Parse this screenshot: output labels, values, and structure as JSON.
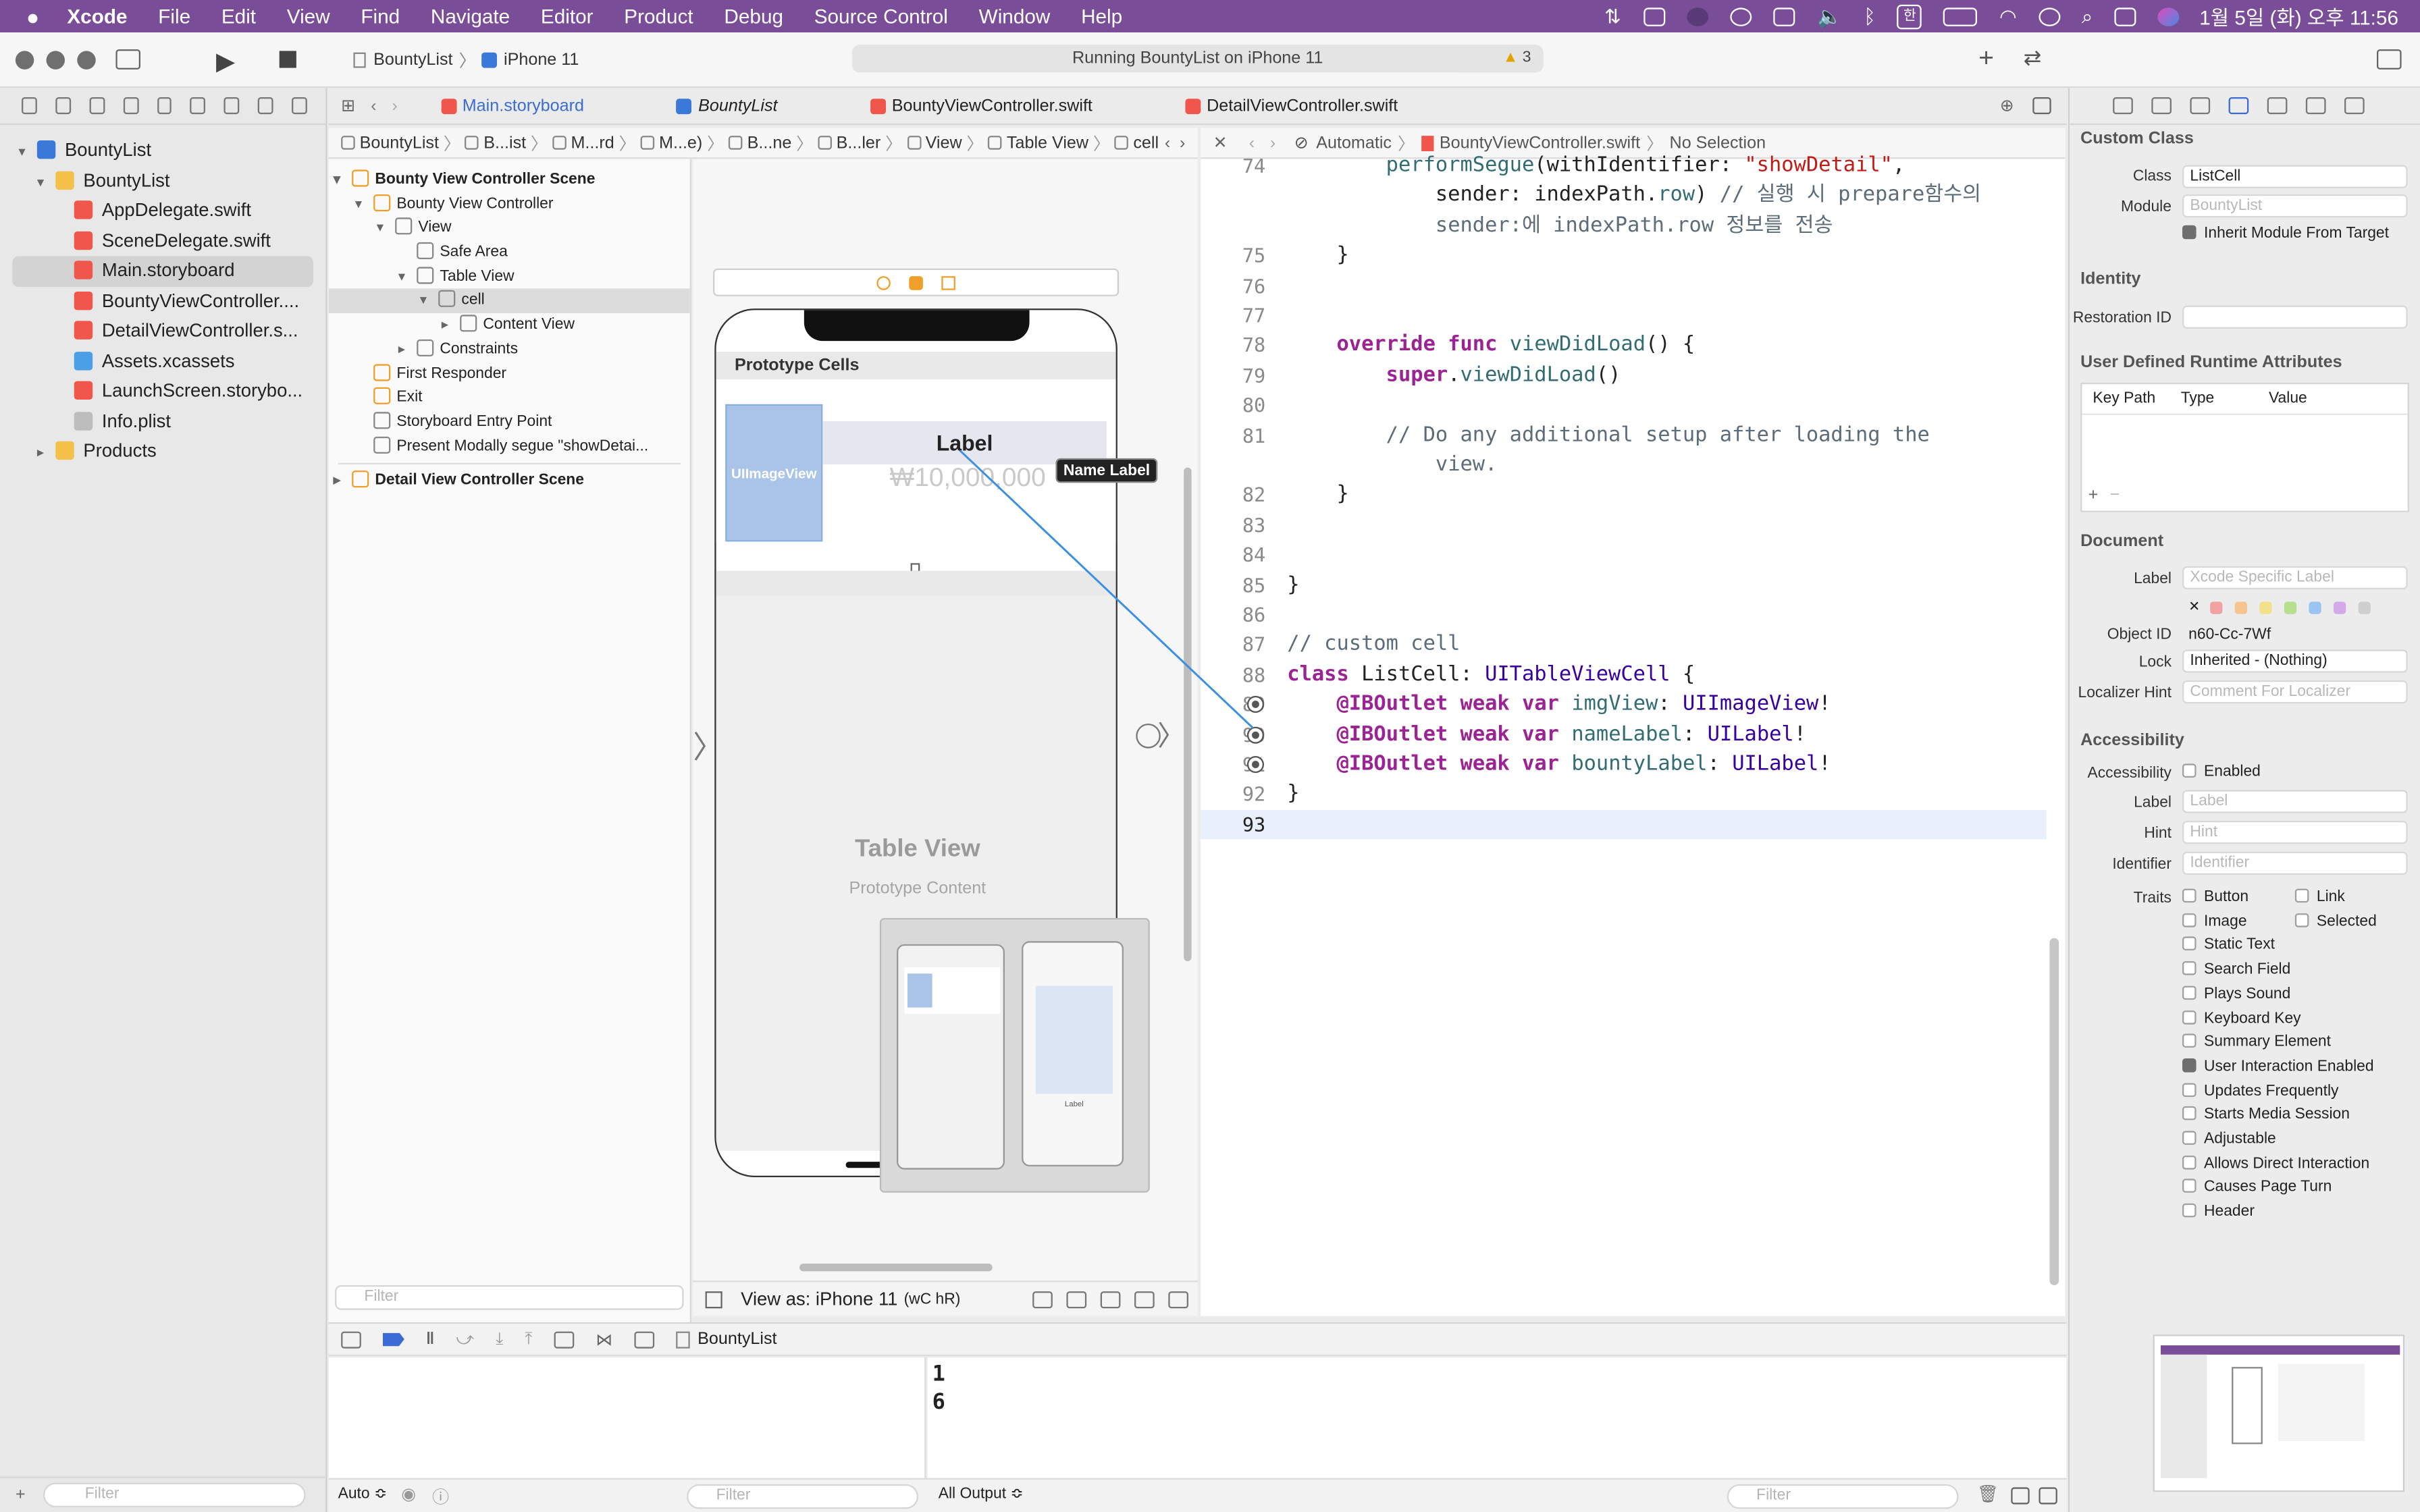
{
  "menubar": {
    "app_name": "Xcode",
    "items": [
      "File",
      "Edit",
      "View",
      "Find",
      "Navigate",
      "Editor",
      "Product",
      "Debug",
      "Source Control",
      "Window",
      "Help"
    ],
    "clock": "1월 5일 (화) 오후 11:56",
    "input_source": "한"
  },
  "toolbar": {
    "scheme": "BountyList",
    "device": "iPhone 11",
    "activity_text": "Running BountyList on iPhone 11",
    "warning_count": "3"
  },
  "tabs": [
    {
      "label": "Main.storyboard",
      "kind": "storyboard"
    },
    {
      "label": "BountyList",
      "kind": "project"
    },
    {
      "label": "BountyViewController.swift",
      "kind": "swift"
    },
    {
      "label": "DetailViewController.swift",
      "kind": "swift"
    }
  ],
  "navigator": {
    "items": [
      {
        "label": "BountyList",
        "kind": "proj",
        "indent": 0,
        "disclosure": "open",
        "selected": false
      },
      {
        "label": "BountyList",
        "kind": "folder",
        "indent": 1,
        "disclosure": "open",
        "selected": false
      },
      {
        "label": "AppDelegate.swift",
        "kind": "swift",
        "indent": 2,
        "disclosure": "",
        "selected": false
      },
      {
        "label": "SceneDelegate.swift",
        "kind": "swift",
        "indent": 2,
        "disclosure": "",
        "selected": false
      },
      {
        "label": "Main.storyboard",
        "kind": "sb",
        "indent": 2,
        "disclosure": "",
        "selected": true
      },
      {
        "label": "BountyViewController....",
        "kind": "swift",
        "indent": 2,
        "disclosure": "",
        "selected": false
      },
      {
        "label": "DetailViewController.s...",
        "kind": "swift",
        "indent": 2,
        "disclosure": "",
        "selected": false
      },
      {
        "label": "Assets.xcassets",
        "kind": "assets",
        "indent": 2,
        "disclosure": "",
        "selected": false
      },
      {
        "label": "LaunchScreen.storybo...",
        "kind": "sb",
        "indent": 2,
        "disclosure": "",
        "selected": false
      },
      {
        "label": "Info.plist",
        "kind": "plist",
        "indent": 2,
        "disclosure": "",
        "selected": false
      },
      {
        "label": "Products",
        "kind": "folder",
        "indent": 1,
        "disclosure": "closed",
        "selected": false
      }
    ],
    "filter_placeholder": "Filter"
  },
  "jumpbar_left": [
    "BountyList",
    "B...ist",
    "M...rd",
    "M...e)",
    "B...ne",
    "B...ler",
    "View",
    "Table View",
    "cell"
  ],
  "jumpbar_right": {
    "mode": "Automatic",
    "file": "BountyViewController.swift",
    "selection": "No Selection"
  },
  "outline": {
    "items": [
      {
        "label": "Bounty View Controller Scene",
        "indent": 0,
        "disclosure": "open",
        "bold": true,
        "selected": false
      },
      {
        "label": "Bounty View Controller",
        "indent": 1,
        "disclosure": "open",
        "bold": false,
        "selected": false
      },
      {
        "label": "View",
        "indent": 2,
        "disclosure": "open",
        "bold": false,
        "selected": false
      },
      {
        "label": "Safe Area",
        "indent": 3,
        "disclosure": "",
        "bold": false,
        "selected": false
      },
      {
        "label": "Table View",
        "indent": 3,
        "disclosure": "open",
        "bold": false,
        "selected": false
      },
      {
        "label": "cell",
        "indent": 4,
        "disclosure": "open",
        "bold": false,
        "selected": true
      },
      {
        "label": "Content View",
        "indent": 5,
        "disclosure": "closed",
        "bold": false,
        "selected": false
      },
      {
        "label": "Constraints",
        "indent": 3,
        "disclosure": "closed",
        "bold": false,
        "selected": false
      },
      {
        "label": "First Responder",
        "indent": 1,
        "disclosure": "",
        "bold": false,
        "selected": false
      },
      {
        "label": "Exit",
        "indent": 1,
        "disclosure": "",
        "bold": false,
        "selected": false
      },
      {
        "label": "Storyboard Entry Point",
        "indent": 1,
        "disclosure": "",
        "bold": false,
        "selected": false
      },
      {
        "label": "Present Modally segue \"showDetai...",
        "indent": 1,
        "disclosure": "",
        "bold": false,
        "selected": false
      },
      {
        "label": "Detail View Controller Scene",
        "indent": 0,
        "disclosure": "closed",
        "bold": true,
        "selected": false
      }
    ],
    "filter_placeholder": "Filter"
  },
  "canvas": {
    "prototype_cells": "Prototype Cells",
    "image_placeholder": "UIImageView",
    "name_label": "Label",
    "bounty_label": "₩10,000,000",
    "connection_tooltip": "Name Label",
    "table_view_title": "Table View",
    "table_view_subtitle": "Prototype Content",
    "view_as": "View as: iPhone 11",
    "view_as_size": "(wC hR)",
    "mini_label": "Label"
  },
  "code": {
    "lines": [
      {
        "num": "74",
        "html": "        <span class=\"fn\">performSegue</span>(withIdentifier: <span class=\"st\">\"showDetail\"</span>,"
      },
      {
        "num": "",
        "html": "            sender: indexPath.<span class=\"fn\">row</span>) <span class=\"cm\">// 실행 시 prepare함수의</span>"
      },
      {
        "num": "",
        "html": "            <span class=\"cm\">sender:에 indexPath.row 정보를 전송</span>"
      },
      {
        "num": "75",
        "html": "    }"
      },
      {
        "num": "76",
        "html": ""
      },
      {
        "num": "77",
        "html": ""
      },
      {
        "num": "78",
        "html": "    <span class=\"kw\">override</span> <span class=\"kw\">func</span> <span class=\"fn\">viewDidLoad</span>() {"
      },
      {
        "num": "79",
        "html": "        <span class=\"kw\">super</span>.<span class=\"fn\">viewDidLoad</span>()"
      },
      {
        "num": "80",
        "html": ""
      },
      {
        "num": "81",
        "html": "        <span class=\"cm\">// Do any additional setup after loading the</span>"
      },
      {
        "num": "",
        "html": "            <span class=\"cm\">view.</span>"
      },
      {
        "num": "82",
        "html": "    }"
      },
      {
        "num": "83",
        "html": ""
      },
      {
        "num": "84",
        "html": ""
      },
      {
        "num": "85",
        "html": "}"
      },
      {
        "num": "86",
        "html": ""
      },
      {
        "num": "87",
        "html": "<span class=\"cm\">// custom cell</span>"
      },
      {
        "num": "88",
        "html": "<span class=\"kw\">class</span> ListCell: <span class=\"ty\">UITableViewCell</span> {"
      },
      {
        "num": "89",
        "html": "    <span class=\"kw\">@IBOutlet</span> <span class=\"kw\">weak</span> <span class=\"kw\">var</span> <span class=\"fn\">imgView</span>: <span class=\"ty\">UIImageView</span>!"
      },
      {
        "num": "90",
        "html": "    <span class=\"kw\">@IBOutlet</span> <span class=\"kw\">weak</span> <span class=\"kw\">var</span> <span class=\"fn\">nameLabel</span>: <span class=\"ty\">UILabel</span>!"
      },
      {
        "num": "91",
        "html": "    <span class=\"kw\">@IBOutlet</span> <span class=\"kw\">weak</span> <span class=\"kw\">var</span> <span class=\"fn\">bountyLabel</span>: <span class=\"ty\">UILabel</span>!"
      },
      {
        "num": "92",
        "html": "}"
      },
      {
        "num": "93",
        "html": ""
      }
    ]
  },
  "inspector": {
    "custom_class_title": "Custom Class",
    "class_label": "Class",
    "class_value": "ListCell",
    "module_label": "Module",
    "module_placeholder": "BountyList",
    "inherit_module": "Inherit Module From Target",
    "identity_title": "Identity",
    "restoration_id_label": "Restoration ID",
    "udra_title": "User Defined Runtime Attributes",
    "udra_columns": [
      "Key Path",
      "Type",
      "Value"
    ],
    "document_title": "Document",
    "doc_label_label": "Label",
    "doc_label_placeholder": "Xcode Specific Label",
    "object_id_label": "Object ID",
    "object_id_value": "n60-Cc-7Wf",
    "lock_label": "Lock",
    "lock_value": "Inherited - (Nothing)",
    "localizer_hint_label": "Localizer Hint",
    "localizer_hint_placeholder": "Comment For Localizer",
    "accessibility_title": "Accessibility",
    "acc_accessibility_label": "Accessibility",
    "acc_enabled": "Enabled",
    "acc_label_label": "Label",
    "acc_label_placeholder": "Label",
    "acc_hint_label": "Hint",
    "acc_hint_placeholder": "Hint",
    "acc_identifier_label": "Identifier",
    "acc_identifier_placeholder": "Identifier",
    "traits_label": "Traits",
    "traits": [
      {
        "label": "Button",
        "checked": false
      },
      {
        "label": "Link",
        "checked": false
      },
      {
        "label": "Image",
        "checked": false
      },
      {
        "label": "Selected",
        "checked": false
      },
      {
        "label": "Static Text",
        "checked": false
      },
      {
        "label": "Search Field",
        "checked": false
      },
      {
        "label": "Plays Sound",
        "checked": false
      },
      {
        "label": "Keyboard Key",
        "checked": false
      },
      {
        "label": "Summary Element",
        "checked": false
      },
      {
        "label": "User Interaction Enabled",
        "checked": true
      },
      {
        "label": "Updates Frequently",
        "checked": false
      },
      {
        "label": "Starts Media Session",
        "checked": false
      },
      {
        "label": "Adjustable",
        "checked": false
      },
      {
        "label": "Allows Direct Interaction",
        "checked": false
      },
      {
        "label": "Causes Page Turn",
        "checked": false
      },
      {
        "label": "Header",
        "checked": false
      }
    ],
    "label_colors": [
      "#f1a3a3",
      "#f6c48f",
      "#f3e08a",
      "#b6df8f",
      "#9cc4f2",
      "#d3a9e8",
      "#cfcfcf"
    ]
  },
  "debug": {
    "target": "BountyList",
    "console_lines": [
      "1",
      "6"
    ],
    "auto_label": "Auto ≎",
    "filter_placeholder": "Filter",
    "output_label": "All Output ≎"
  },
  "colors": {
    "menubar": "#7a4d98",
    "accent": "#3b6cd6",
    "keyword": "#9b2393",
    "connection": "#3d8fe0"
  }
}
